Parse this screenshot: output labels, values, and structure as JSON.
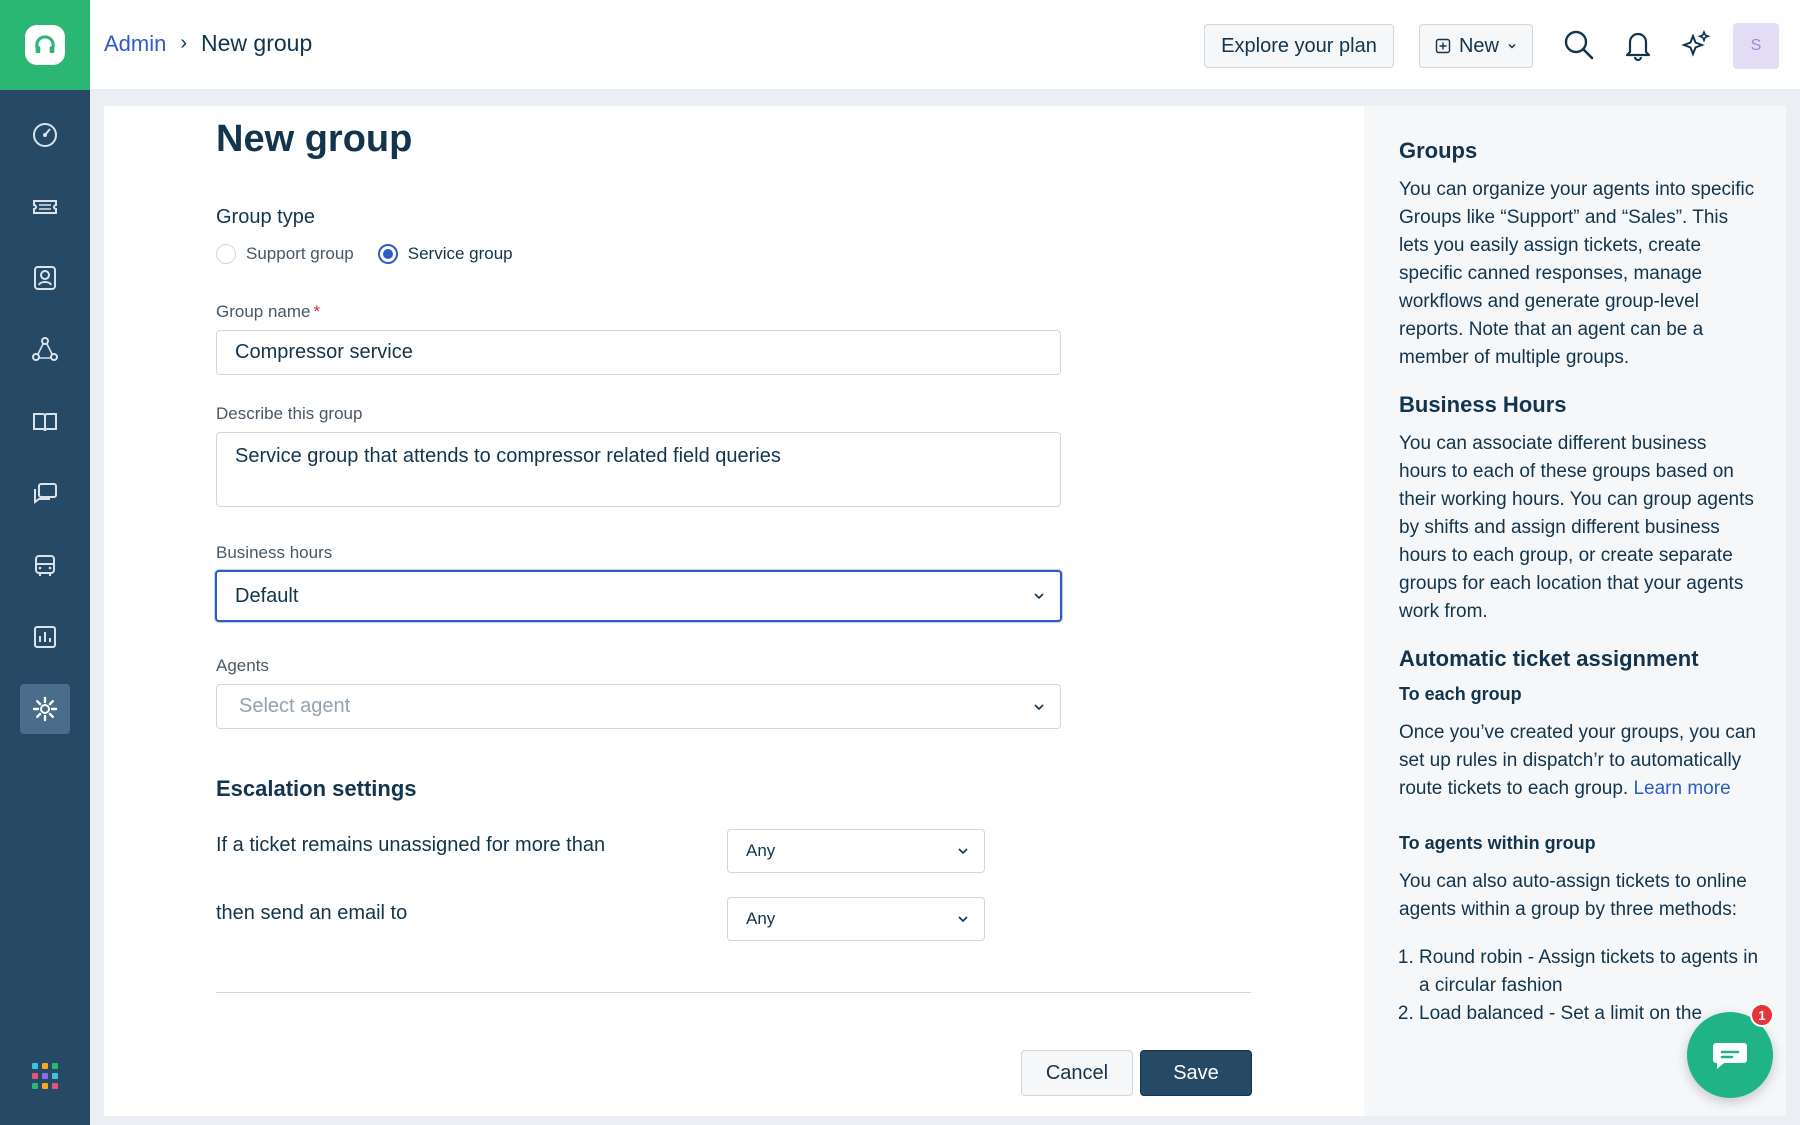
{
  "breadcrumb": {
    "root": "Admin",
    "current": "New group"
  },
  "header": {
    "explore_label": "Explore your plan",
    "new_label": "New",
    "avatar_initial": "S"
  },
  "page": {
    "title": "New group"
  },
  "form": {
    "group_type_label": "Group type",
    "group_type_options": [
      "Support group",
      "Service group"
    ],
    "group_type_selected": "Service group",
    "group_name_label": "Group name",
    "group_name_value": "Compressor service",
    "description_label": "Describe this group",
    "description_value": "Service group that attends to compressor related field queries",
    "business_hours_label": "Business hours",
    "business_hours_value": "Default",
    "agents_label": "Agents",
    "agents_placeholder": "Select agent",
    "escalation_title": "Escalation settings",
    "escalation_unassigned_text": "If a ticket remains unassigned for more than",
    "escalation_unassigned_value": "Any",
    "escalation_email_text": "then send an email to",
    "escalation_email_value": "Any",
    "cancel_label": "Cancel",
    "save_label": "Save"
  },
  "help": {
    "groups_title": "Groups",
    "groups_text": "You can organize your agents into specific Groups like “Support” and “Sales”. This lets you easily assign tickets, create specific canned responses, manage workflows and generate group-level reports. Note that an agent can be a member of multiple groups.",
    "hours_title": "Business Hours",
    "hours_text": "You can associate different business hours to each of these groups based on their working hours. You can group agents by shifts and assign different business hours to each group, or create separate groups for each location that your agents work from.",
    "assign_title": "Automatic ticket assignment",
    "each_group_title": "To each group",
    "each_group_text": "Once you’ve created your groups, you can set up rules in dispatch’r to automatically route tickets to each group.",
    "learn_more": "Learn more",
    "within_group_title": "To agents within group",
    "within_group_text": "You can also auto-assign tickets to online agents within a group by three methods:",
    "methods": [
      "Round robin - Assign tickets to agents in a circular fashion",
      "Load balanced - Set a limit on the"
    ]
  },
  "chat": {
    "badge_count": "1"
  },
  "colors": {
    "brand_green": "#2bb673",
    "rail": "#264966",
    "accent_blue": "#2c5cc5",
    "save_button": "#264966"
  }
}
